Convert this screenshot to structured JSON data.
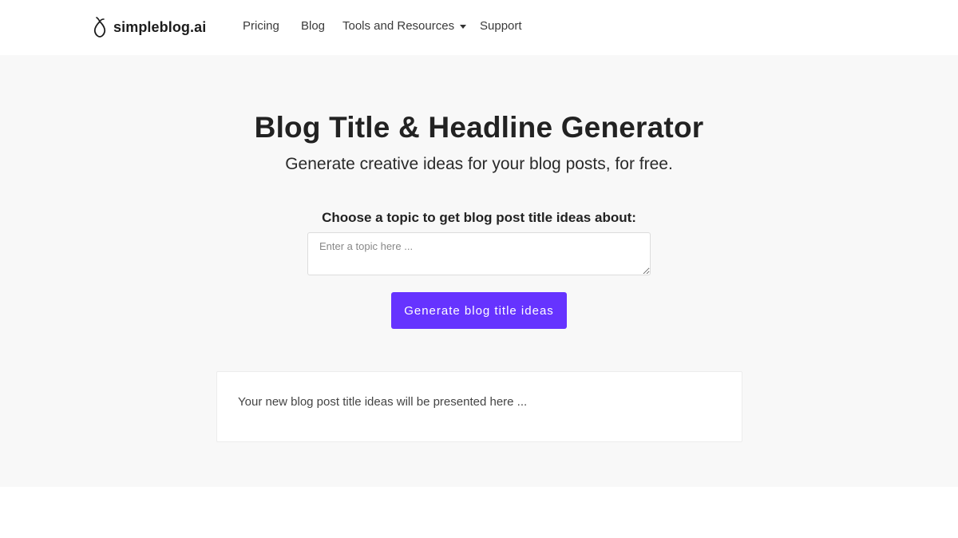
{
  "brand": {
    "name": "simpleblog.ai",
    "icon": "leaf-drop-icon"
  },
  "nav": {
    "items": [
      {
        "label": "Pricing"
      },
      {
        "label": "Blog"
      },
      {
        "label": "Tools and Resources",
        "has_dropdown": true
      },
      {
        "label": "Support"
      }
    ]
  },
  "hero": {
    "title": "Blog Title & Headline Generator",
    "subtitle": "Generate creative ideas for your blog posts, for free."
  },
  "form": {
    "label": "Choose a topic to get blog post title ideas about:",
    "input_value": "",
    "input_placeholder": "Enter a topic here ...",
    "button_label": "Generate blog title ideas"
  },
  "results": {
    "placeholder": "Your new blog post title ideas will be presented here ..."
  },
  "colors": {
    "accent": "#6633ff",
    "hero_background": "#f8f8f8",
    "text_dark": "#222222"
  }
}
